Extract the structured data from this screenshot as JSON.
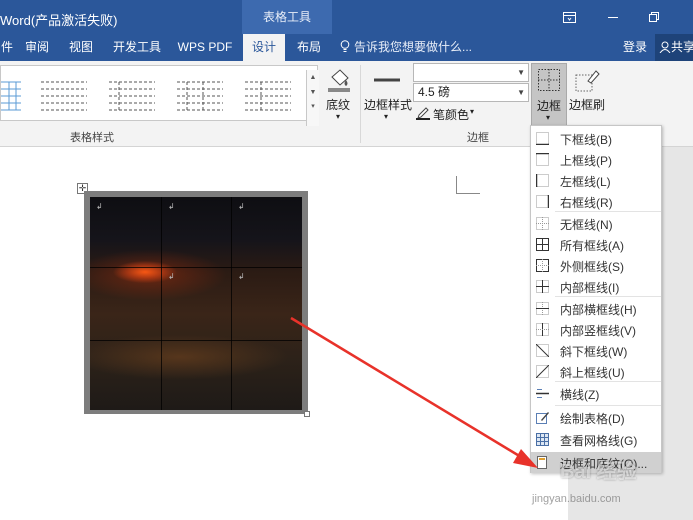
{
  "title_bar": {
    "title": "Word(产品激活失败)",
    "context_tab": "表格工具"
  },
  "tabs": [
    {
      "label": "件"
    },
    {
      "label": "审阅"
    },
    {
      "label": "视图"
    },
    {
      "label": "开发工具"
    },
    {
      "label": "WPS PDF"
    },
    {
      "label": "设计"
    },
    {
      "label": "布局"
    }
  ],
  "tell_me": "告诉我您想要做什么...",
  "login": "登录",
  "share": "共享",
  "ribbon": {
    "table_styles_group": "表格样式",
    "shading_label": "底纹",
    "border_styles_label": "边框样式",
    "pen_weight": "4.5 磅",
    "pen_color_label": "笔颜色",
    "borders_group": "边框",
    "borders_button": "边框",
    "border_painter": "边框刷"
  },
  "borders_menu": [
    {
      "label": "下框线(B)",
      "icon": "border-bottom-icon"
    },
    {
      "label": "上框线(P)",
      "icon": "border-top-icon"
    },
    {
      "label": "左框线(L)",
      "icon": "border-left-icon"
    },
    {
      "label": "右框线(R)",
      "icon": "border-right-icon"
    },
    {
      "label": "无框线(N)",
      "icon": "border-none-icon"
    },
    {
      "label": "所有框线(A)",
      "icon": "border-all-icon"
    },
    {
      "label": "外侧框线(S)",
      "icon": "border-outside-icon"
    },
    {
      "label": "内部框线(I)",
      "icon": "border-inside-icon"
    },
    {
      "label": "内部横框线(H)",
      "icon": "border-inside-horizontal-icon"
    },
    {
      "label": "内部竖框线(V)",
      "icon": "border-inside-vertical-icon"
    },
    {
      "label": "斜下框线(W)",
      "icon": "diagonal-down-icon"
    },
    {
      "label": "斜上框线(U)",
      "icon": "diagonal-up-icon"
    },
    {
      "label": "横线(Z)",
      "icon": "horizontal-line-icon"
    },
    {
      "label": "绘制表格(D)",
      "icon": "draw-table-icon"
    },
    {
      "label": "查看网格线(G)",
      "icon": "view-gridlines-icon"
    },
    {
      "label": "边框和底纹(O)...",
      "icon": "borders-shading-icon"
    }
  ],
  "watermark": "Bai 经验",
  "watermark_sub": "jingyan.baidu.com"
}
